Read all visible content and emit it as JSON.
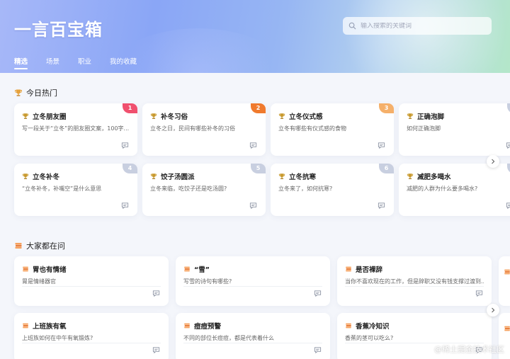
{
  "app": {
    "title": "一言百宝箱"
  },
  "search": {
    "placeholder": "输入搜索的关键词"
  },
  "nav": {
    "tabs": [
      "精选",
      "场景",
      "职业",
      "我的收藏"
    ],
    "active_index": 0
  },
  "hot": {
    "title": "今日热门",
    "cards": [
      {
        "title": "立冬朋友圈",
        "desc": "写一段关于“立冬”的朋友圈文案，100字...",
        "rank": "1",
        "rank_color": "#f0506e"
      },
      {
        "title": "补冬习俗",
        "desc": "立冬之日，民间有哪些补冬的习俗",
        "rank": "2",
        "rank_color": "#f07a2d"
      },
      {
        "title": "立冬仪式感",
        "desc": "立冬有哪些有仪式感的食物",
        "rank": "3",
        "rank_color": "#f5b06a"
      },
      {
        "title": "正确泡脚",
        "desc": "如何正确泡脚",
        "rank": "",
        "rank_color": "#c8cfe0"
      },
      {
        "title": "立冬补冬",
        "desc": "“立冬补冬，补嘴空”是什么意思",
        "rank": "4",
        "rank_color": "#c8cfe0"
      },
      {
        "title": "饺子汤圆派",
        "desc": "立冬来临，吃饺子还是吃汤圆?",
        "rank": "5",
        "rank_color": "#c8cfe0"
      },
      {
        "title": "立冬抗寒",
        "desc": "立冬来了，如何抗寒?",
        "rank": "6",
        "rank_color": "#c8cfe0"
      },
      {
        "title": "减肥多喝水",
        "desc": "减肥的人群为什么要多喝水?",
        "rank": "",
        "rank_color": "#c8cfe0"
      }
    ]
  },
  "ask": {
    "title": "大家都在问",
    "cards": [
      {
        "title": "胃也有情绪",
        "desc": "胃是情绪器官"
      },
      {
        "title": "“雪”",
        "desc": "写雪的诗句有哪些?"
      },
      {
        "title": "是否裸辞",
        "desc": "当你不喜欢现在的工作，但是辞职又没有钱支撑过渡到..."
      },
      {
        "title": "上班族有氧",
        "desc": "上班族如何在中午有氧锻炼?"
      },
      {
        "title": "痘痘预警",
        "desc": "不同的部位长痘痘，都是代表着什么"
      },
      {
        "title": "香蕉冷知识",
        "desc": "香蕉的茎可以吃么?"
      }
    ]
  },
  "watermark": "@稀土掘金技术社区",
  "colors": {
    "accent": "#8aa6f6",
    "trophy": "#e6a23c",
    "book": "#f08a4b"
  }
}
